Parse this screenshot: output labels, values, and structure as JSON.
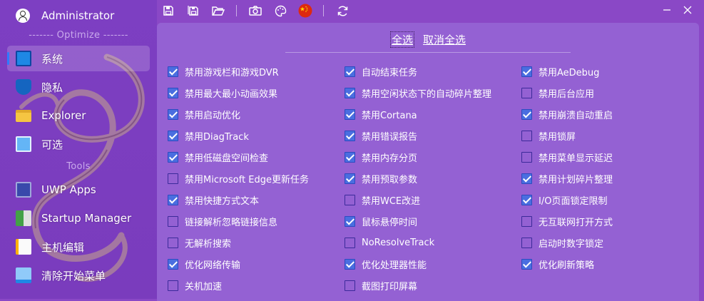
{
  "user": {
    "name": "Administrator"
  },
  "sidebar": {
    "optimize_label": "------- Optimize -------",
    "tools_label": "Tools",
    "items": [
      {
        "label": "系统",
        "icon": "monitor-icon",
        "active": true
      },
      {
        "label": "隐私",
        "icon": "shield-icon",
        "active": false
      },
      {
        "label": "Explorer",
        "icon": "folder-icon",
        "active": false
      },
      {
        "label": "可选",
        "icon": "optional-features-icon",
        "active": false
      },
      {
        "label": "UWP Apps",
        "icon": "uwp-apps-icon",
        "active": false
      },
      {
        "label": "Startup Manager",
        "icon": "startup-icon",
        "active": false
      },
      {
        "label": "主机编辑",
        "icon": "hosts-edit-icon",
        "active": false
      },
      {
        "label": "清除开始菜单",
        "icon": "start-menu-icon",
        "active": false
      }
    ]
  },
  "toolbar": {
    "buttons": [
      "save-icon",
      "save-all-icon",
      "open-folder-icon",
      "camera-icon",
      "palette-icon",
      "china-flag-icon",
      "refresh-icon"
    ]
  },
  "main": {
    "select_all": "全选",
    "deselect_all": "取消全选",
    "columns": [
      [
        {
          "label": "禁用游戏栏和游戏DVR",
          "checked": true
        },
        {
          "label": "禁用最大最小动画效果",
          "checked": true
        },
        {
          "label": "禁用启动优化",
          "checked": true
        },
        {
          "label": "禁用DiagTrack",
          "checked": true
        },
        {
          "label": "禁用低磁盘空间检查",
          "checked": true
        },
        {
          "label": "禁用Microsoft Edge更新任务",
          "checked": false
        },
        {
          "label": "禁用快捷方式文本",
          "checked": true
        },
        {
          "label": "链接解析忽略链接信息",
          "checked": false
        },
        {
          "label": "无解析搜索",
          "checked": false
        },
        {
          "label": "优化网络传输",
          "checked": true
        },
        {
          "label": "关机加速",
          "checked": false
        }
      ],
      [
        {
          "label": "自动结束任务",
          "checked": true
        },
        {
          "label": "禁用空闲状态下的自动碎片整理",
          "checked": true
        },
        {
          "label": "禁用Cortana",
          "checked": true
        },
        {
          "label": "禁用错误报告",
          "checked": true
        },
        {
          "label": "禁用内存分页",
          "checked": true
        },
        {
          "label": "禁用预取参数",
          "checked": true
        },
        {
          "label": "禁用WCE改进",
          "checked": false
        },
        {
          "label": "鼠标悬停时间",
          "checked": true
        },
        {
          "label": "NoResolveTrack",
          "checked": false
        },
        {
          "label": "优化处理器性能",
          "checked": true
        },
        {
          "label": "截图打印屏幕",
          "checked": false
        }
      ],
      [
        {
          "label": "禁用AeDebug",
          "checked": true
        },
        {
          "label": "禁用后台应用",
          "checked": false
        },
        {
          "label": "禁用崩溃自动重启",
          "checked": true
        },
        {
          "label": "禁用锁屏",
          "checked": false
        },
        {
          "label": "禁用菜单显示延迟",
          "checked": false
        },
        {
          "label": "禁用计划碎片整理",
          "checked": true
        },
        {
          "label": "I/O页面锁定限制",
          "checked": true
        },
        {
          "label": "无互联网打开方式",
          "checked": false
        },
        {
          "label": "启动时数字锁定",
          "checked": false
        },
        {
          "label": "优化刷新策略",
          "checked": true
        }
      ]
    ]
  }
}
